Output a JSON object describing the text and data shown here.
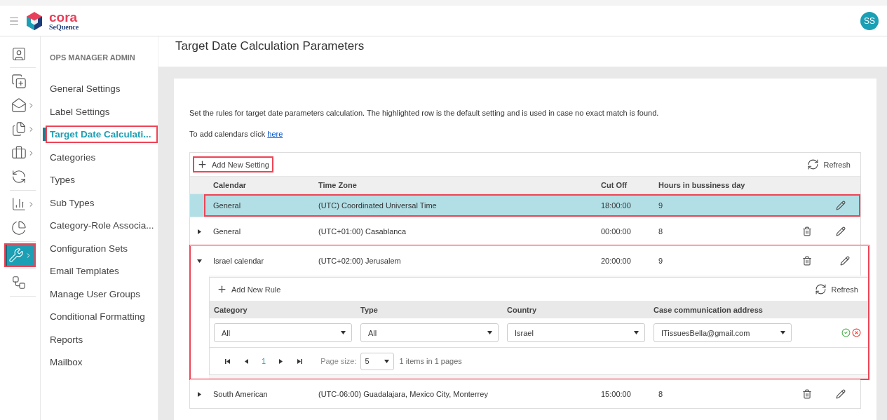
{
  "header": {
    "logo": {
      "name": "cora",
      "tagline": "SeQuence"
    },
    "avatar": "SS"
  },
  "rail": [
    [
      {
        "kind": "contact",
        "submenu": false,
        "selected": false,
        "annotated": false
      }
    ],
    [
      {
        "kind": "add",
        "submenu": false,
        "selected": false,
        "annotated": false
      },
      {
        "kind": "inbox",
        "submenu": true,
        "selected": false,
        "annotated": false
      },
      {
        "kind": "documents",
        "submenu": true,
        "selected": false,
        "annotated": false
      },
      {
        "kind": "briefcase",
        "submenu": true,
        "selected": false,
        "annotated": false
      },
      {
        "kind": "cycle",
        "submenu": false,
        "selected": false,
        "annotated": false
      }
    ],
    [
      {
        "kind": "chart",
        "submenu": true,
        "selected": false,
        "annotated": false
      },
      {
        "kind": "pie",
        "submenu": false,
        "selected": false,
        "annotated": false
      }
    ],
    [
      {
        "kind": "tools",
        "submenu": true,
        "selected": true,
        "annotated": true
      }
    ],
    [
      {
        "kind": "flow",
        "submenu": false,
        "selected": false,
        "annotated": false
      }
    ]
  ],
  "submenu": {
    "title": "OPS MANAGER ADMIN",
    "items": [
      {
        "label": "General Settings",
        "selected": false,
        "annotated": false
      },
      {
        "label": "Label Settings",
        "selected": false,
        "annotated": false
      },
      {
        "label": "Target Date Calculati...",
        "selected": true,
        "annotated": true
      },
      {
        "label": "Categories",
        "selected": false,
        "annotated": false
      },
      {
        "label": "Types",
        "selected": false,
        "annotated": false
      },
      {
        "label": "Sub Types",
        "selected": false,
        "annotated": false
      },
      {
        "label": "Category-Role Associa...",
        "selected": false,
        "annotated": false
      },
      {
        "label": "Configuration Sets",
        "selected": false,
        "annotated": false
      },
      {
        "label": "Email Templates",
        "selected": false,
        "annotated": false
      },
      {
        "label": "Manage User Groups",
        "selected": false,
        "annotated": false
      },
      {
        "label": "Conditional Formatting",
        "selected": false,
        "annotated": false
      },
      {
        "label": "Reports",
        "selected": false,
        "annotated": false
      },
      {
        "label": "Mailbox",
        "selected": false,
        "annotated": false
      }
    ]
  },
  "page": {
    "title": "Target Date Calculation Parameters",
    "intro": "Set the rules for target date parameters calculation. The highlighted row is the default setting and is used in case no exact match is found.",
    "calendar_hint": "To add calendars click",
    "calendar_link": "here"
  },
  "grid": {
    "add_button": {
      "label": "Add New Setting",
      "annotated": true
    },
    "refresh": "Refresh",
    "columns": [
      "Calendar",
      "Time Zone",
      "Cut Off",
      "Hours in bussiness day"
    ],
    "rows": [
      {
        "calendar": "General",
        "time_zone": "(UTC) Coordinated Universal Time",
        "cut_off": "18:00:00",
        "hours": "9",
        "selected": true,
        "deletable": false,
        "annotated": true
      },
      {
        "calendar": "General",
        "time_zone": "(UTC+01:00) Casablanca",
        "cut_off": "00:00:00",
        "hours": "8",
        "selected": false,
        "deletable": true,
        "expanded": false,
        "annotated": false
      },
      {
        "calendar": "Israel calendar",
        "time_zone": "(UTC+02:00) Jerusalem",
        "cut_off": "20:00:00",
        "hours": "9",
        "selected": false,
        "deletable": true,
        "expanded": true,
        "annotated": true,
        "detail": {
          "add_button": "Add New Rule",
          "refresh": "Refresh",
          "columns": [
            "Category",
            "Type",
            "Country",
            "Case communication address"
          ],
          "edit_values": [
            "All",
            "All",
            "Israel",
            "ITissuesBella@gmail.com"
          ],
          "pager": {
            "page": "1",
            "size_label": "Page size:",
            "size": "5",
            "info": "1 items in 1 pages"
          }
        }
      },
      {
        "calendar": "South American",
        "time_zone": "(UTC-06:00) Guadalajara, Mexico City, Monterrey",
        "cut_off": "15:00:00",
        "hours": "8",
        "selected": false,
        "deletable": true,
        "expanded": false,
        "annotated": false
      }
    ]
  }
}
